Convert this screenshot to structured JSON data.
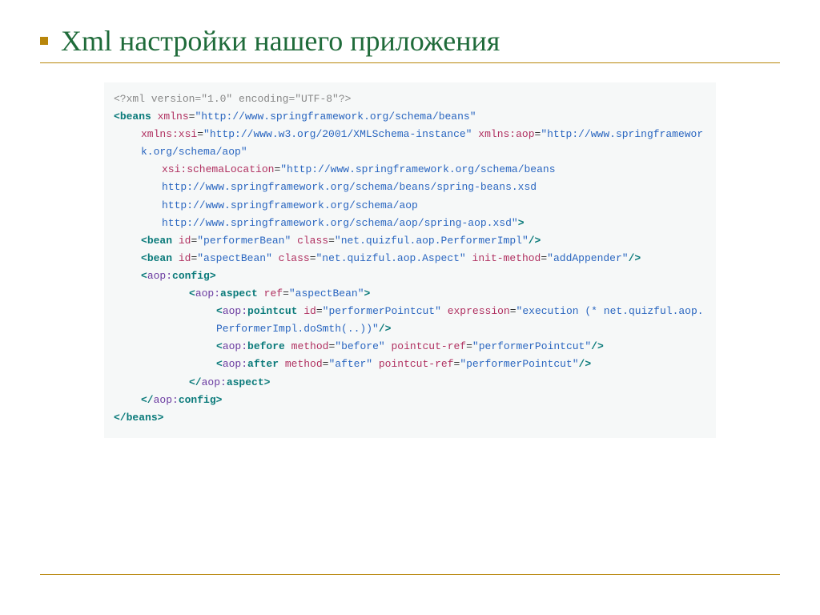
{
  "title": "Xml  настройки нашего приложения",
  "code": {
    "l0a": "<?xml version=",
    "l0b": "\"1.0\"",
    "l0c": " encoding=",
    "l0d": "\"UTF-8\"",
    "l0e": "?>",
    "l1a": "<",
    "l1b": "beans",
    "l1c": " xmlns",
    "l1d": "=",
    "l1e": "\"http://www.springframework.org/schema/beans\"",
    "l2a": "xmlns:xsi",
    "l2b": "=",
    "l2c": "\"http://www.w3.org/2001/XMLSchema-instance\"",
    "l2d": " xmlns:aop",
    "l2e": "=",
    "l2f": "\"http://www.springframework.org/schema/aop\"",
    "l3a": "xsi:schemaLocation",
    "l3b": "=",
    "l3c": "\"http://www.springframework.org/schema/beans",
    "l4": "http://www.springframework.org/schema/beans/spring-beans.xsd",
    "l5": "http://www.springframework.org/schema/aop",
    "l6a": "http://www.springframework.org/schema/aop/spring-aop.xsd\"",
    "l6b": ">",
    "l7a": "<",
    "l7b": "bean",
    "l7c": " id",
    "l7d": "=",
    "l7e": "\"performerBean\"",
    "l7f": " class",
    "l7g": "=",
    "l7h": "\"net.quizful.aop.PerformerImpl\"",
    "l7i": "/>",
    "l8a": "<",
    "l8b": "bean",
    "l8c": " id",
    "l8d": "=",
    "l8e": "\"aspectBean\"",
    "l8f": " class",
    "l8g": "=",
    "l8h": "\"net.quizful.aop.Aspect\"",
    "l8i": " init-method",
    "l8j": "=",
    "l8k": "\"addAppender\"",
    "l8l": "/>",
    "l9a": "<",
    "l9b": "aop:",
    "l9c": "config",
    "l9d": ">",
    "l10a": "<",
    "l10b": "aop:",
    "l10c": "aspect",
    "l10d": " ref",
    "l10e": "=",
    "l10f": "\"aspectBean\"",
    "l10g": ">",
    "l11a": "<",
    "l11b": "aop:",
    "l11c": "pointcut",
    "l11d": " id",
    "l11e": "=",
    "l11f": "\"performerPointcut\"",
    "l11g": " expression",
    "l11h": "=",
    "l11i": "\"execution (* net.quizful.aop.PerformerImpl.doSmth(..))\"",
    "l11j": "/>",
    "l12a": "<",
    "l12b": "aop:",
    "l12c": "before",
    "l12d": " method",
    "l12e": "=",
    "l12f": "\"before\"",
    "l12g": " pointcut-ref",
    "l12h": "=",
    "l12i": "\"performerPointcut\"",
    "l12j": "/>",
    "l13a": "<",
    "l13b": "aop:",
    "l13c": "after",
    "l13d": " method",
    "l13e": "=",
    "l13f": "\"after\"",
    "l13g": " pointcut-ref",
    "l13h": "=",
    "l13i": "\"performerPointcut\"",
    "l13j": "/>",
    "l14a": "</",
    "l14b": "aop:",
    "l14c": "aspect",
    "l14d": ">",
    "l15a": "</",
    "l15b": "aop:",
    "l15c": "config",
    "l15d": ">",
    "l16a": "</",
    "l16b": "beans",
    "l16c": ">"
  }
}
